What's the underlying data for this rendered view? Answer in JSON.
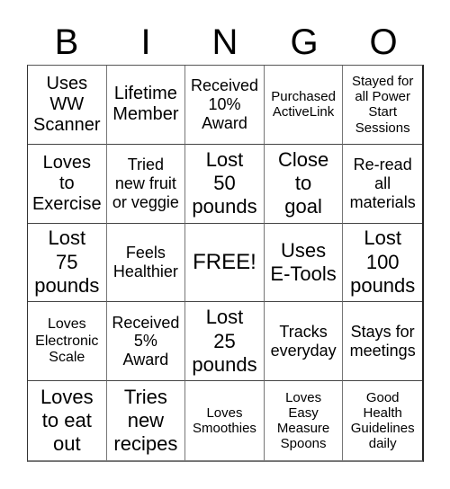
{
  "title_letters": [
    "B",
    "I",
    "N",
    "G",
    "O"
  ],
  "rows": [
    [
      {
        "text": "Uses\nWW\nScanner",
        "size": "s-lg"
      },
      {
        "text": "Lifetime\nMember",
        "size": "s-lg"
      },
      {
        "text": "Received\n10%\nAward",
        "size": "s-md"
      },
      {
        "text": "Purchased\nActiveLink",
        "size": "s-xs"
      },
      {
        "text": "Stayed for\nall Power\nStart\nSessions",
        "size": "s-xs"
      }
    ],
    [
      {
        "text": "Loves\nto\nExercise",
        "size": "s-lg"
      },
      {
        "text": "Tried\nnew fruit\nor veggie",
        "size": "s-md"
      },
      {
        "text": "Lost\n50\npounds",
        "size": "s-xl"
      },
      {
        "text": "Close\nto\ngoal",
        "size": "s-xl"
      },
      {
        "text": "Re-read\nall\nmaterials",
        "size": "s-md"
      }
    ],
    [
      {
        "text": "Lost\n75\npounds",
        "size": "s-xl"
      },
      {
        "text": "Feels\nHealthier",
        "size": "s-md"
      },
      {
        "text": "FREE!",
        "size": "free"
      },
      {
        "text": "Uses\nE-Tools",
        "size": "s-xl"
      },
      {
        "text": "Lost\n100\npounds",
        "size": "s-xl"
      }
    ],
    [
      {
        "text": "Loves\nElectronic\nScale",
        "size": "s-sm"
      },
      {
        "text": "Received\n5%\nAward",
        "size": "s-md"
      },
      {
        "text": "Lost\n25\npounds",
        "size": "s-xl"
      },
      {
        "text": "Tracks\neveryday",
        "size": "s-md"
      },
      {
        "text": "Stays for\nmeetings",
        "size": "s-md"
      }
    ],
    [
      {
        "text": "Loves\nto eat\nout",
        "size": "s-xl"
      },
      {
        "text": "Tries\nnew\nrecipes",
        "size": "s-xl"
      },
      {
        "text": "Loves\nSmoothies",
        "size": "s-xs"
      },
      {
        "text": "Loves\nEasy\nMeasure\nSpoons",
        "size": "s-xs"
      },
      {
        "text": "Good\nHealth\nGuidelines\ndaily",
        "size": "s-xs"
      }
    ]
  ]
}
